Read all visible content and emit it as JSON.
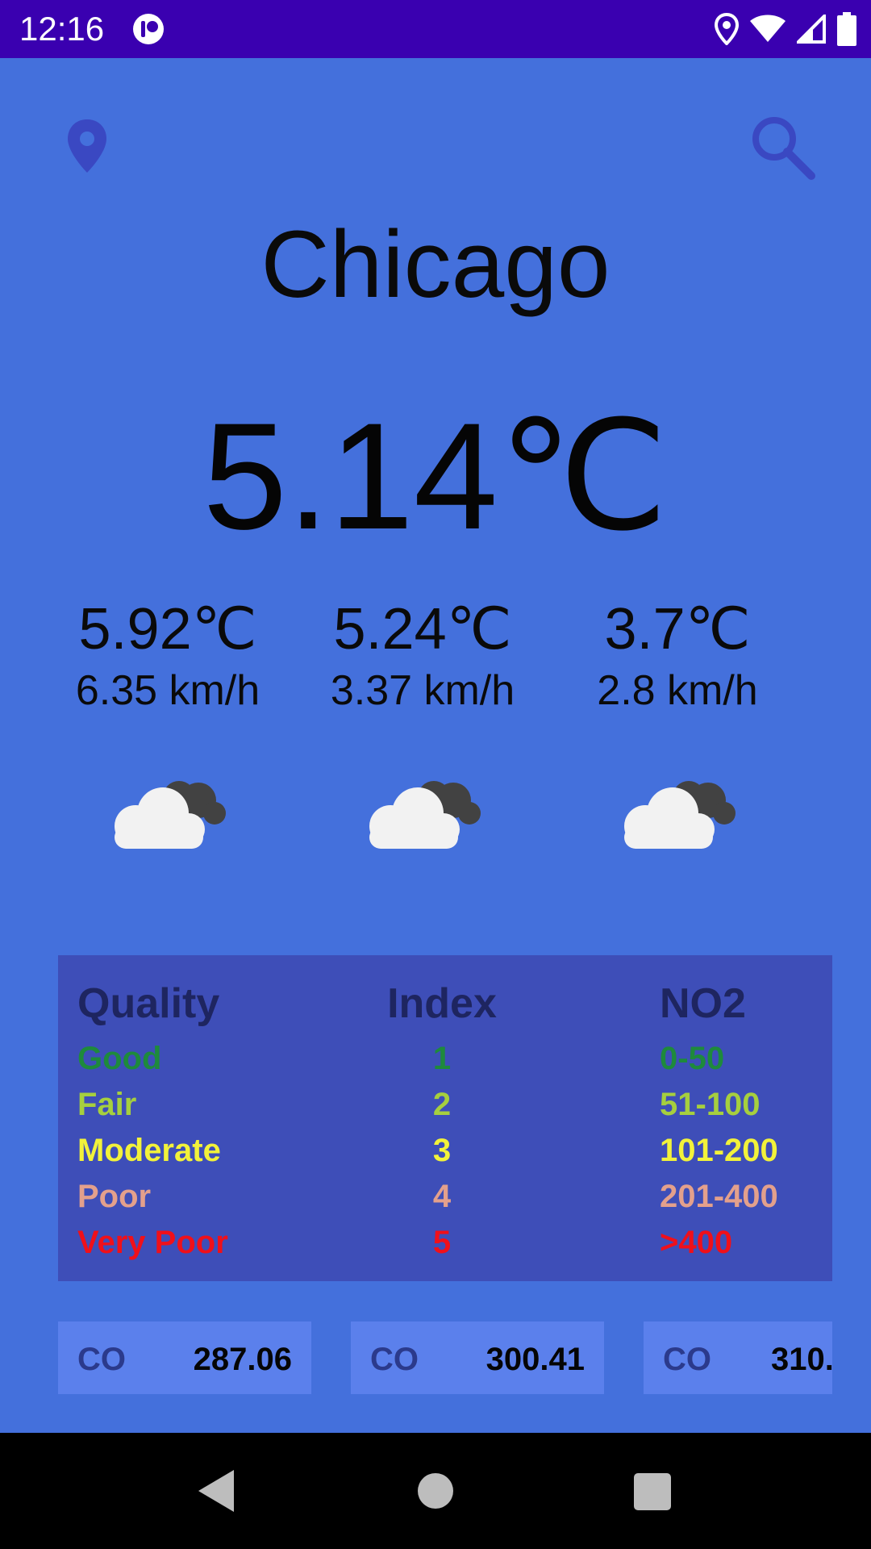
{
  "status_bar": {
    "time": "12:16",
    "icons": [
      "app-badge-icon",
      "location-icon",
      "wifi-icon",
      "cell-signal-icon",
      "battery-icon"
    ]
  },
  "header": {
    "location_icon": "location-pin-icon",
    "search_icon": "search-icon"
  },
  "weather": {
    "city": "Chicago",
    "current_temp": "5.14℃",
    "forecast": [
      {
        "temp": "5.92℃",
        "wind": "6.35 km/h",
        "icon": "cloudy-icon"
      },
      {
        "temp": "5.24℃",
        "wind": "3.37 km/h",
        "icon": "cloudy-icon"
      },
      {
        "temp": "3.7℃",
        "wind": "2.8 km/h",
        "icon": "cloudy-icon"
      }
    ]
  },
  "quality_table": {
    "headers": [
      "Quality",
      "Index",
      "NO2"
    ],
    "rows": [
      {
        "quality": "Good",
        "index": "1",
        "no2": "0-50",
        "color": "#1E8A3C"
      },
      {
        "quality": "Fair",
        "index": "2",
        "no2": "51-100",
        "color": "#A6CF3E"
      },
      {
        "quality": "Moderate",
        "index": "3",
        "no2": "101-200",
        "color": "#F2F23A"
      },
      {
        "quality": "Poor",
        "index": "4",
        "no2": "201-400",
        "color": "#E3A08C"
      },
      {
        "quality": "Very Poor",
        "index": "5",
        "no2": ">400",
        "color": "#F0101A"
      }
    ]
  },
  "co_cards": [
    {
      "label": "CO",
      "value": "287.06"
    },
    {
      "label": "CO",
      "value": "300.41"
    },
    {
      "label": "CO",
      "value": "310."
    }
  ],
  "nav_bar": {
    "icons": [
      "back-icon",
      "home-icon",
      "recents-icon"
    ]
  }
}
